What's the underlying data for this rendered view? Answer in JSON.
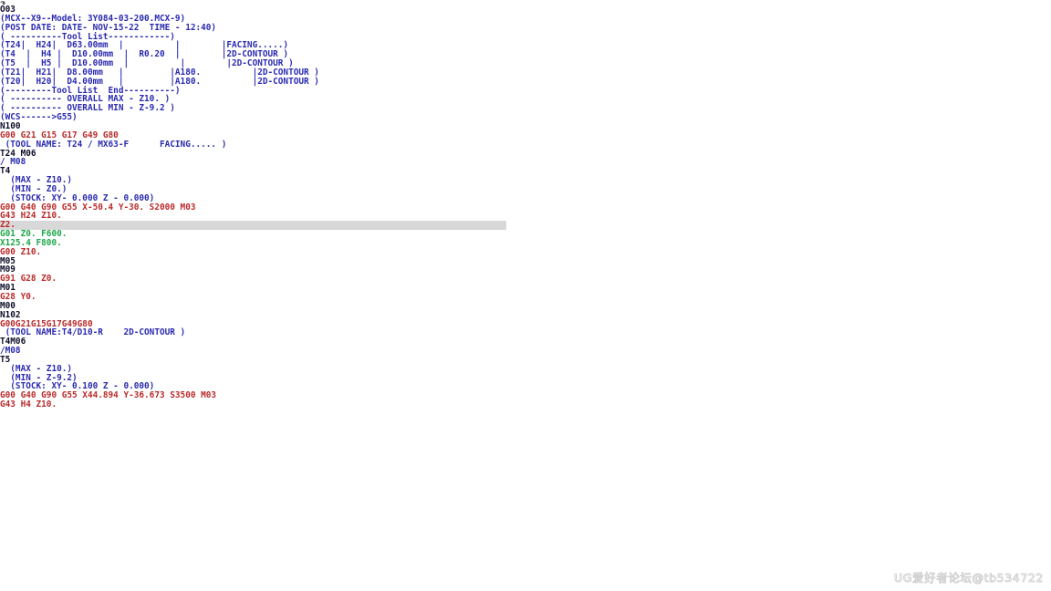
{
  "document": {
    "type": "nc-gcode-program-listing",
    "background_color": "#ffffff",
    "colors": {
      "comment_blue": "#2b2bb0",
      "motion_red": "#bb2b2b",
      "feed_green": "#1fa84a",
      "plain_black": "#0d0d28",
      "highlight_background": "#d8d8d8",
      "watermark": "#cfcfcf"
    }
  },
  "program": {
    "lines": [
      {
        "text": "%",
        "color": "black",
        "clipped": true
      },
      {
        "text": "O03",
        "color": "black"
      },
      {
        "text": "(MCX--X9--Model: 3Y084-03-200.MCX-9)",
        "color": "blue"
      },
      {
        "text": "(POST DATE: DATE- NOV-15-22  TIME - 12:40)",
        "color": "blue"
      },
      {
        "text": "( ----------Tool List------------)",
        "color": "blue"
      },
      {
        "text": "(T24|  H24|  D63.00mm  |          |        |FACING.....)",
        "color": "blue"
      },
      {
        "text": "(T4  |  H4 |  D10.00mm  |  R0.20  |        |2D-CONTOUR )",
        "color": "blue"
      },
      {
        "text": "(T5  |  H5 |  D10.00mm  |          |        |2D-CONTOUR )",
        "color": "blue"
      },
      {
        "text": "(T21|  H21|  D8.00mm   |         |A180.          |2D-CONTOUR )",
        "color": "blue"
      },
      {
        "text": "(T20|  H20|  D4.00mm   |         |A180.          |2D-CONTOUR )",
        "color": "blue"
      },
      {
        "text": "(---------Tool List  End----------)",
        "color": "blue"
      },
      {
        "text": "( ---------- OVERALL MAX - Z10. )",
        "color": "blue"
      },
      {
        "text": "( ---------- OVERALL MIN - Z-9.2 )",
        "color": "blue"
      },
      {
        "text": "(WCS------>G55)",
        "color": "blue"
      },
      {
        "text": "N100",
        "color": "black"
      },
      {
        "text": "G00 G21 G15 G17 G49 G80",
        "color": "red"
      },
      {
        "text": " (TOOL NAME: T24 / MX63-F      FACING..... )",
        "color": "blue"
      },
      {
        "text": "T24 M06",
        "color": "black"
      },
      {
        "text": "/ M08",
        "color": "blue"
      },
      {
        "text": "T4",
        "color": "black"
      },
      {
        "text": "  (MAX - Z10.)",
        "color": "blue"
      },
      {
        "text": "  (MIN - Z0.)",
        "color": "blue"
      },
      {
        "text": "  (STOCK: XY- 0.000 Z - 0.000)",
        "color": "blue"
      },
      {
        "text": "G00 G40 G90 G55 X-50.4 Y-30. S2000 M03",
        "color": "red"
      },
      {
        "text": "G43 H24 Z10.",
        "color": "red"
      },
      {
        "text": "Z2.",
        "color": "red",
        "highlighted": true
      },
      {
        "text": "G01 Z0. F600.",
        "color": "green"
      },
      {
        "text": "X125.4 F800.",
        "color": "green"
      },
      {
        "text": "G00 Z10.",
        "color": "red"
      },
      {
        "text": "M05",
        "color": "black"
      },
      {
        "text": "M09",
        "color": "black"
      },
      {
        "text": "G91 G28 Z0.",
        "color": "red"
      },
      {
        "text": "M01",
        "color": "black"
      },
      {
        "text": "G28 Y0.",
        "color": "red"
      },
      {
        "text": "M00",
        "color": "black"
      },
      {
        "text": "N102",
        "color": "black"
      },
      {
        "text": "G00G21G15G17G49G80",
        "color": "red"
      },
      {
        "text": " (TOOL NAME:T4/D10-R    2D-CONTOUR )",
        "color": "blue"
      },
      {
        "text": "T4M06",
        "color": "black"
      },
      {
        "text": "/M08",
        "color": "blue"
      },
      {
        "text": "T5",
        "color": "black"
      },
      {
        "text": "  (MAX - Z10.)",
        "color": "blue"
      },
      {
        "text": "  (MIN - Z-9.2)",
        "color": "blue"
      },
      {
        "text": "  (STOCK: XY- 0.100 Z - 0.000)",
        "color": "blue"
      },
      {
        "text": "G00 G40 G90 G55 X44.894 Y-36.673 S3500 M03",
        "color": "red"
      },
      {
        "text": "G43 H4 Z10.",
        "color": "red"
      }
    ]
  },
  "watermark": {
    "text": "UG爱好者论坛@tb534722"
  }
}
